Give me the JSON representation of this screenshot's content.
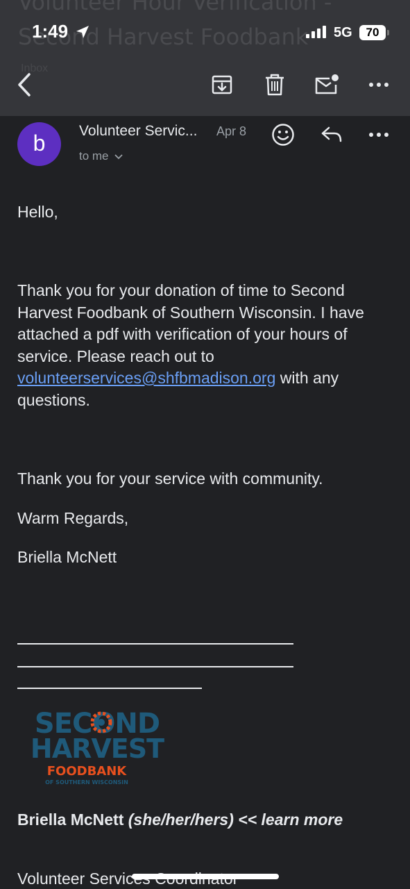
{
  "status_bar": {
    "time": "1:49",
    "network": "5G",
    "battery": "70"
  },
  "subject": {
    "line1": "Volunteer Hour Verification -",
    "line2": "Second Harvest Foodbank",
    "label": "Inbox"
  },
  "toolbar": {
    "icons": [
      "back-icon",
      "archive-icon",
      "trash-icon",
      "mark-unread-icon",
      "more-icon"
    ]
  },
  "message": {
    "avatar_letter": "b",
    "sender": "Volunteer Servic...",
    "date": "Apr 8",
    "recipient": "to me",
    "greeting": "Hello,",
    "para1_before": "Thank you for your donation of time to Second Harvest Foodbank of Southern Wisconsin. I have attached a pdf with verification of your hours of service. Please reach out to ",
    "email_link": "volunteerservices@shfbmadison.org",
    "para1_after": " with any questions.",
    "thanks": "Thank you for your service with community.",
    "closing": "Warm Regards,",
    "signoff_name": "Briella McNett"
  },
  "signature": {
    "logo_line1": "SECOND",
    "logo_line2": "HARVEST",
    "logo_line3": "FOODBANK",
    "logo_line4": "OF SOUTHERN WISCONSIN",
    "name": "Briella McNett",
    "pronouns": "(she/her/hers) << learn more",
    "title": "Volunteer Services Coordinator"
  },
  "colors": {
    "background": "#202124",
    "topbar": "#35363a",
    "avatar": "#5d2fc1",
    "link": "#6a9ff5",
    "logo_blue": "#1f5a7a",
    "logo_orange": "#e8501e"
  }
}
